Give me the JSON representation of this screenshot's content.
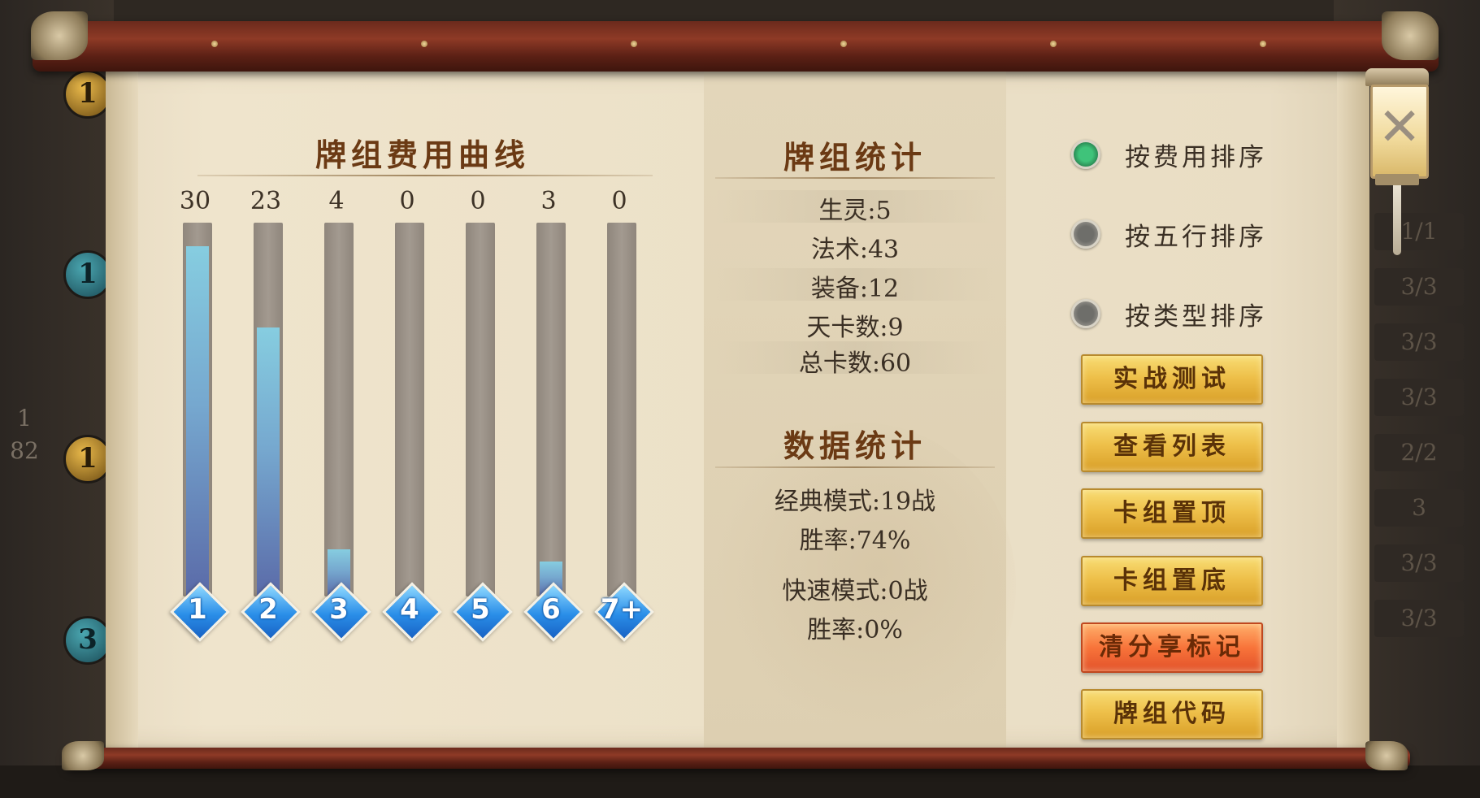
{
  "background": {
    "left_badges": [
      "1",
      "1",
      "1",
      "3"
    ],
    "pager": [
      "1",
      "82"
    ],
    "right_counts": [
      "1/1",
      "3/3",
      "3/3",
      "3/3",
      "2/2",
      "3",
      "3/3",
      "3/3"
    ]
  },
  "curve": {
    "title": "牌组费用曲线",
    "bars": [
      {
        "cost": "1",
        "count": "30"
      },
      {
        "cost": "2",
        "count": "23"
      },
      {
        "cost": "3",
        "count": "4"
      },
      {
        "cost": "4",
        "count": "0"
      },
      {
        "cost": "5",
        "count": "0"
      },
      {
        "cost": "6",
        "count": "3"
      },
      {
        "cost": "7+",
        "count": "0"
      }
    ]
  },
  "chart_data": {
    "type": "bar",
    "categories": [
      "1",
      "2",
      "3",
      "4",
      "5",
      "6",
      "7+"
    ],
    "values": [
      30,
      23,
      4,
      0,
      0,
      3,
      0
    ],
    "title": "牌组费用曲线",
    "ylim": [
      0,
      32
    ]
  },
  "deck_stats": {
    "title": "牌组统计",
    "items": [
      "生灵:5",
      "法术:43",
      "装备:12",
      "天卡数:9",
      "总卡数:60"
    ]
  },
  "data_stats": {
    "title": "数据统计",
    "classic_battles": "经典模式:19战",
    "classic_winrate": "胜率:74%",
    "quick_battles": "快速模式:0战",
    "quick_winrate": "胜率:0%"
  },
  "sort": {
    "options": [
      "按费用排序",
      "按五行排序",
      "按类型排序"
    ],
    "selected": 0
  },
  "buttons": {
    "battle_test": "实战测试",
    "view_list": "查看列表",
    "pin_top": "卡组置顶",
    "pin_bottom": "卡组置底",
    "clear_share": "清分享标记",
    "deck_code": "牌组代码"
  },
  "colors": {
    "bar_fill_top": "#86cde0",
    "bar_fill_bottom": "#5a6aa8",
    "radio_on": "#3fc37a",
    "button_gold": "#eec04a",
    "button_orange": "#f8743a",
    "heading": "#6b3a14"
  },
  "icons": {
    "close": "close-icon",
    "radio": "radio-icon"
  }
}
